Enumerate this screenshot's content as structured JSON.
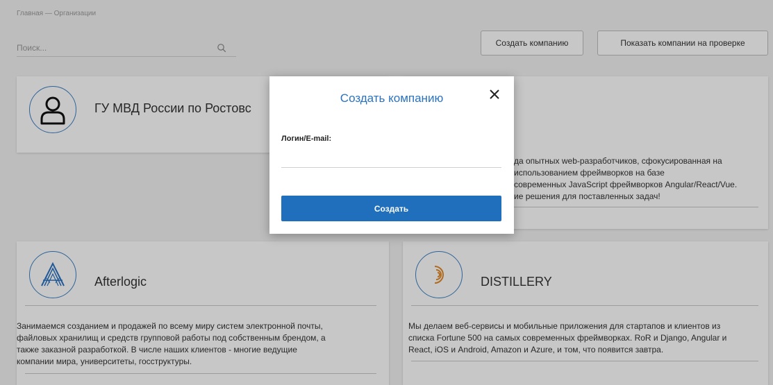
{
  "breadcrumb": "Главная — Организации",
  "search": {
    "placeholder": "Поиск..."
  },
  "toolbar": {
    "create_label": "Создать компанию",
    "review_label": "Показать компании на проверке"
  },
  "cards": {
    "mvd": {
      "name": "ГУ МВД России по Ростовс"
    },
    "partial": {
      "description_lines": [
        "да опытных web-разработчиков, сфокусированная на",
        "использованием фреймворков на базе",
        "современных JavaScript фреймворков Angular/React/Vue.",
        "ие решения для поставленных задач!"
      ]
    },
    "afterlogic": {
      "name": "Afterlogic",
      "description_lines": [
        "Занимаемся созданием и продажей по всему миру систем электронной почты,",
        "файловых хранилищ и средств групповой работы под собственным брендом, а",
        "также заказной разработкой. В числе наших клиентов - многие ведущие",
        "компании мира, университеты, госструктуры."
      ]
    },
    "distillery": {
      "name": "DISTILLERY",
      "description_lines": [
        "Мы делаем веб-сервисы и мобильные приложения для стартапов и клиентов из",
        "списка Fortune 500 на самых современных фреймворках. RoR и Django, Angular и",
        "React, iOS и Android, Amazon и Azure, и том, что появится завтра."
      ]
    }
  },
  "modal": {
    "title": "Создать компанию",
    "login_label": "Логин/E-mail:",
    "login_value": "",
    "submit_label": "Создать"
  },
  "colors": {
    "accent": "#2a72c0",
    "button": "#1f6fbd",
    "distillery_logo": "#e08a2a"
  },
  "icons": {
    "search": "search-icon",
    "close": "close-icon",
    "user": "user-icon",
    "afterlogic_logo": "afterlogic-logo-icon",
    "distillery_logo": "distillery-logo-icon"
  }
}
